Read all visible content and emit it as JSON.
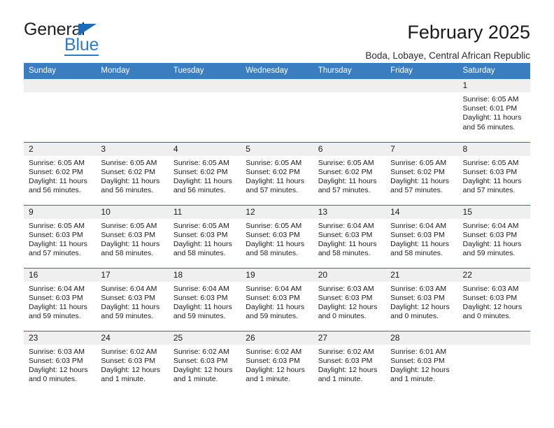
{
  "brand": {
    "name_top": "General",
    "name_bottom": "Blue",
    "accent_color": "#2b7cc4",
    "header_color": "#3b7ebf",
    "rule_color": "#2e6da4",
    "daynum_band_color": "#efefef"
  },
  "header": {
    "title": "February 2025",
    "subtitle": "Boda, Lobaye, Central African Republic"
  },
  "weekday_headers": [
    "Sunday",
    "Monday",
    "Tuesday",
    "Wednesday",
    "Thursday",
    "Friday",
    "Saturday"
  ],
  "weeks": [
    [
      {
        "day": "",
        "blank": true,
        "sunrise": "",
        "sunset": "",
        "daylight": ""
      },
      {
        "day": "",
        "blank": true,
        "sunrise": "",
        "sunset": "",
        "daylight": ""
      },
      {
        "day": "",
        "blank": true,
        "sunrise": "",
        "sunset": "",
        "daylight": ""
      },
      {
        "day": "",
        "blank": true,
        "sunrise": "",
        "sunset": "",
        "daylight": ""
      },
      {
        "day": "",
        "blank": true,
        "sunrise": "",
        "sunset": "",
        "daylight": ""
      },
      {
        "day": "",
        "blank": true,
        "sunrise": "",
        "sunset": "",
        "daylight": ""
      },
      {
        "day": "1",
        "blank": false,
        "sunrise": "Sunrise: 6:05 AM",
        "sunset": "Sunset: 6:01 PM",
        "daylight": "Daylight: 11 hours and 56 minutes."
      }
    ],
    [
      {
        "day": "2",
        "blank": false,
        "sunrise": "Sunrise: 6:05 AM",
        "sunset": "Sunset: 6:02 PM",
        "daylight": "Daylight: 11 hours and 56 minutes."
      },
      {
        "day": "3",
        "blank": false,
        "sunrise": "Sunrise: 6:05 AM",
        "sunset": "Sunset: 6:02 PM",
        "daylight": "Daylight: 11 hours and 56 minutes."
      },
      {
        "day": "4",
        "blank": false,
        "sunrise": "Sunrise: 6:05 AM",
        "sunset": "Sunset: 6:02 PM",
        "daylight": "Daylight: 11 hours and 56 minutes."
      },
      {
        "day": "5",
        "blank": false,
        "sunrise": "Sunrise: 6:05 AM",
        "sunset": "Sunset: 6:02 PM",
        "daylight": "Daylight: 11 hours and 57 minutes."
      },
      {
        "day": "6",
        "blank": false,
        "sunrise": "Sunrise: 6:05 AM",
        "sunset": "Sunset: 6:02 PM",
        "daylight": "Daylight: 11 hours and 57 minutes."
      },
      {
        "day": "7",
        "blank": false,
        "sunrise": "Sunrise: 6:05 AM",
        "sunset": "Sunset: 6:02 PM",
        "daylight": "Daylight: 11 hours and 57 minutes."
      },
      {
        "day": "8",
        "blank": false,
        "sunrise": "Sunrise: 6:05 AM",
        "sunset": "Sunset: 6:03 PM",
        "daylight": "Daylight: 11 hours and 57 minutes."
      }
    ],
    [
      {
        "day": "9",
        "blank": false,
        "sunrise": "Sunrise: 6:05 AM",
        "sunset": "Sunset: 6:03 PM",
        "daylight": "Daylight: 11 hours and 57 minutes."
      },
      {
        "day": "10",
        "blank": false,
        "sunrise": "Sunrise: 6:05 AM",
        "sunset": "Sunset: 6:03 PM",
        "daylight": "Daylight: 11 hours and 58 minutes."
      },
      {
        "day": "11",
        "blank": false,
        "sunrise": "Sunrise: 6:05 AM",
        "sunset": "Sunset: 6:03 PM",
        "daylight": "Daylight: 11 hours and 58 minutes."
      },
      {
        "day": "12",
        "blank": false,
        "sunrise": "Sunrise: 6:05 AM",
        "sunset": "Sunset: 6:03 PM",
        "daylight": "Daylight: 11 hours and 58 minutes."
      },
      {
        "day": "13",
        "blank": false,
        "sunrise": "Sunrise: 6:04 AM",
        "sunset": "Sunset: 6:03 PM",
        "daylight": "Daylight: 11 hours and 58 minutes."
      },
      {
        "day": "14",
        "blank": false,
        "sunrise": "Sunrise: 6:04 AM",
        "sunset": "Sunset: 6:03 PM",
        "daylight": "Daylight: 11 hours and 58 minutes."
      },
      {
        "day": "15",
        "blank": false,
        "sunrise": "Sunrise: 6:04 AM",
        "sunset": "Sunset: 6:03 PM",
        "daylight": "Daylight: 11 hours and 59 minutes."
      }
    ],
    [
      {
        "day": "16",
        "blank": false,
        "sunrise": "Sunrise: 6:04 AM",
        "sunset": "Sunset: 6:03 PM",
        "daylight": "Daylight: 11 hours and 59 minutes."
      },
      {
        "day": "17",
        "blank": false,
        "sunrise": "Sunrise: 6:04 AM",
        "sunset": "Sunset: 6:03 PM",
        "daylight": "Daylight: 11 hours and 59 minutes."
      },
      {
        "day": "18",
        "blank": false,
        "sunrise": "Sunrise: 6:04 AM",
        "sunset": "Sunset: 6:03 PM",
        "daylight": "Daylight: 11 hours and 59 minutes."
      },
      {
        "day": "19",
        "blank": false,
        "sunrise": "Sunrise: 6:04 AM",
        "sunset": "Sunset: 6:03 PM",
        "daylight": "Daylight: 11 hours and 59 minutes."
      },
      {
        "day": "20",
        "blank": false,
        "sunrise": "Sunrise: 6:03 AM",
        "sunset": "Sunset: 6:03 PM",
        "daylight": "Daylight: 12 hours and 0 minutes."
      },
      {
        "day": "21",
        "blank": false,
        "sunrise": "Sunrise: 6:03 AM",
        "sunset": "Sunset: 6:03 PM",
        "daylight": "Daylight: 12 hours and 0 minutes."
      },
      {
        "day": "22",
        "blank": false,
        "sunrise": "Sunrise: 6:03 AM",
        "sunset": "Sunset: 6:03 PM",
        "daylight": "Daylight: 12 hours and 0 minutes."
      }
    ],
    [
      {
        "day": "23",
        "blank": false,
        "sunrise": "Sunrise: 6:03 AM",
        "sunset": "Sunset: 6:03 PM",
        "daylight": "Daylight: 12 hours and 0 minutes."
      },
      {
        "day": "24",
        "blank": false,
        "sunrise": "Sunrise: 6:02 AM",
        "sunset": "Sunset: 6:03 PM",
        "daylight": "Daylight: 12 hours and 1 minute."
      },
      {
        "day": "25",
        "blank": false,
        "sunrise": "Sunrise: 6:02 AM",
        "sunset": "Sunset: 6:03 PM",
        "daylight": "Daylight: 12 hours and 1 minute."
      },
      {
        "day": "26",
        "blank": false,
        "sunrise": "Sunrise: 6:02 AM",
        "sunset": "Sunset: 6:03 PM",
        "daylight": "Daylight: 12 hours and 1 minute."
      },
      {
        "day": "27",
        "blank": false,
        "sunrise": "Sunrise: 6:02 AM",
        "sunset": "Sunset: 6:03 PM",
        "daylight": "Daylight: 12 hours and 1 minute."
      },
      {
        "day": "28",
        "blank": false,
        "sunrise": "Sunrise: 6:01 AM",
        "sunset": "Sunset: 6:03 PM",
        "daylight": "Daylight: 12 hours and 1 minute."
      },
      {
        "day": "",
        "blank": true,
        "sunrise": "",
        "sunset": "",
        "daylight": ""
      }
    ]
  ]
}
